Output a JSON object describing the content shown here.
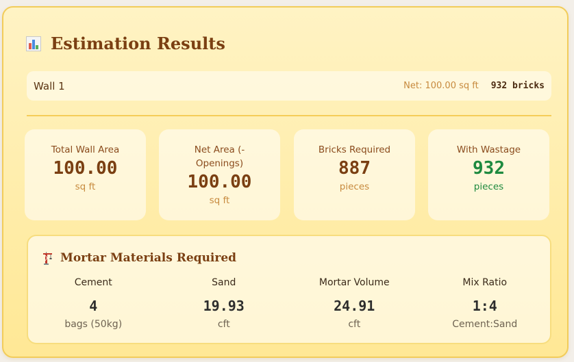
{
  "header": {
    "icon": "bar-chart-icon",
    "title": "Estimation Results"
  },
  "wall": {
    "name": "Wall 1",
    "net_area": "Net: 100.00 sq ft",
    "bricks": "932 bricks"
  },
  "stats": [
    {
      "label": "Total Wall Area",
      "value": "100.00",
      "unit": "sq ft"
    },
    {
      "label": "Net Area (-Openings)",
      "value": "100.00",
      "unit": "sq ft"
    },
    {
      "label": "Bricks Required",
      "value": "887",
      "unit": "pieces"
    },
    {
      "label": "With Wastage",
      "value": "932",
      "unit": "pieces"
    }
  ],
  "mortar": {
    "icon": "crane-icon",
    "title": "Mortar Materials Required",
    "items": [
      {
        "label": "Cement",
        "value": "4",
        "unit": "bags (50kg)"
      },
      {
        "label": "Sand",
        "value": "19.93",
        "unit": "cft"
      },
      {
        "label": "Mortar Volume",
        "value": "24.91",
        "unit": "cft"
      },
      {
        "label": "Mix Ratio",
        "value": "1:4",
        "unit": "Cement:Sand"
      }
    ]
  },
  "colors": {
    "title": "#7a3f12",
    "accent_border": "#f2cc5a",
    "highlight_green": "#1e8a3f",
    "muted_unit": "#c78a3e"
  }
}
